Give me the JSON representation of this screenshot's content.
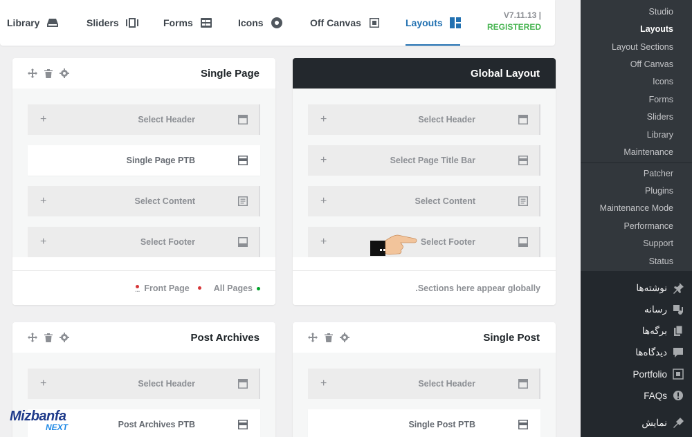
{
  "tabs": [
    {
      "label": "Library",
      "icon": "library-icon"
    },
    {
      "label": "Sliders",
      "icon": "sliders-icon"
    },
    {
      "label": "Forms",
      "icon": "forms-icon"
    },
    {
      "label": "Icons",
      "icon": "icons-icon"
    },
    {
      "label": "Off Canvas",
      "icon": "off-canvas-icon"
    },
    {
      "label": "Layouts",
      "icon": "layouts-icon",
      "active": true
    }
  ],
  "version": {
    "number": "V7.11.13",
    "separator": "|",
    "status": "REGISTERED"
  },
  "cards": {
    "single_page": {
      "title": "Single Page",
      "slots": [
        {
          "label": "Select Header",
          "filled": false
        },
        {
          "label": "Single Page PTB",
          "filled": true
        },
        {
          "label": "Select Content",
          "filled": false
        },
        {
          "label": "Select Footer",
          "filled": false
        }
      ],
      "footer": {
        "front_page": "Front Page",
        "all_pages": "All Pages"
      }
    },
    "global_layout": {
      "title": "Global Layout",
      "slots": [
        {
          "label": "Select Header"
        },
        {
          "label": "Select Page Title Bar"
        },
        {
          "label": "Select Content"
        },
        {
          "label": "Select Footer"
        }
      ],
      "footer_note": ".Sections here appear globally"
    },
    "post_archives": {
      "title": "Post Archives",
      "slots": [
        {
          "label": "Select Header",
          "filled": false
        },
        {
          "label": "Post Archives PTB",
          "filled": true
        }
      ]
    },
    "single_post": {
      "title": "Single Post",
      "slots": [
        {
          "label": "Select Header",
          "filled": false
        },
        {
          "label": "Single Post PTB",
          "filled": true
        }
      ]
    }
  },
  "sidebar": {
    "submenu": [
      "Studio",
      "Layouts",
      "Layout Sections",
      "Off Canvas",
      "Icons",
      "Forms",
      "Sliders",
      "Library",
      "Maintenance"
    ],
    "current": "Layouts",
    "submenu2": [
      "Patcher",
      "Plugins",
      "Maintenance Mode",
      "Performance",
      "Support",
      "Status"
    ],
    "main": [
      {
        "label": "نوشته‌ها",
        "icon": "pin-icon"
      },
      {
        "label": "رسانه",
        "icon": "media-icon"
      },
      {
        "label": "برگه‌ها",
        "icon": "pages-icon"
      },
      {
        "label": "دیدگاه‌ها",
        "icon": "comments-icon"
      },
      {
        "label": "Portfolio",
        "icon": "portfolio-icon"
      },
      {
        "label": "FAQs",
        "icon": "faq-icon"
      },
      {
        "label": "نمایش",
        "icon": "appearance-icon"
      }
    ]
  },
  "logo": {
    "line1": "Mizbanfa",
    "line2": "NEXT"
  },
  "colors": {
    "accent": "#2271b1",
    "registered": "#46b450",
    "sidebar": "#23282d",
    "submenu": "#32373c",
    "dot_red": "#d63638",
    "dot_green": "#00a32a"
  }
}
